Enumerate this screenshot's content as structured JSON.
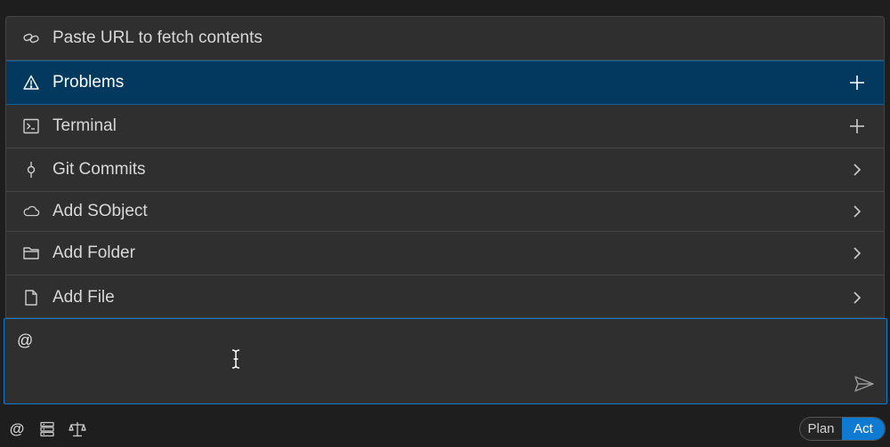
{
  "menu": {
    "items": [
      {
        "label": "Paste URL to fetch contents",
        "icon": "link-icon",
        "action": "none"
      },
      {
        "label": "Problems",
        "icon": "warning-icon",
        "action": "plus"
      },
      {
        "label": "Terminal",
        "icon": "terminal-icon",
        "action": "plus"
      },
      {
        "label": "Git Commits",
        "icon": "git-commit-icon",
        "action": "chevron"
      },
      {
        "label": "Add SObject",
        "icon": "cloud-icon",
        "action": "chevron"
      },
      {
        "label": "Add Folder",
        "icon": "folder-icon",
        "action": "chevron"
      },
      {
        "label": "Add File",
        "icon": "file-icon",
        "action": "chevron"
      }
    ],
    "selected_index": 1
  },
  "input": {
    "value": "@"
  },
  "toolbar": {
    "icons": [
      "at-icon",
      "server-icon",
      "scale-icon"
    ],
    "at_label": "@"
  },
  "mode": {
    "plan_label": "Plan",
    "act_label": "Act",
    "active": "Act"
  },
  "colors": {
    "selected_bg": "#03395e",
    "accent": "#0e7ad1",
    "panel_bg": "#2f2f2f"
  }
}
